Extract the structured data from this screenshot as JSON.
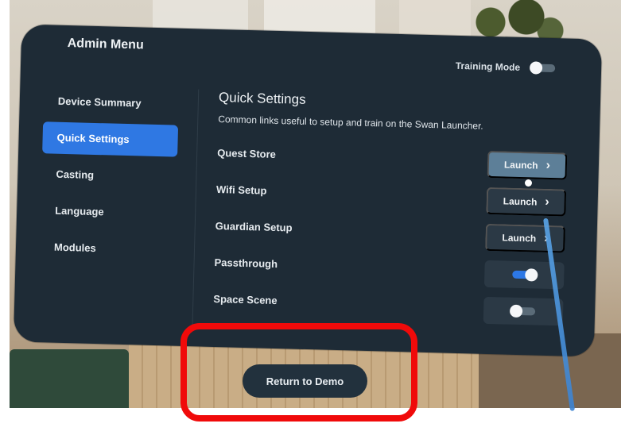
{
  "panel": {
    "title": "Admin Menu",
    "training_mode": {
      "label": "Training Mode",
      "on": false
    }
  },
  "sidebar": {
    "items": [
      {
        "label": "Device Summary",
        "active": false
      },
      {
        "label": "Quick Settings",
        "active": true
      },
      {
        "label": "Casting",
        "active": false
      },
      {
        "label": "Language",
        "active": false
      },
      {
        "label": "Modules",
        "active": false
      }
    ]
  },
  "main": {
    "title": "Quick Settings",
    "subtitle": "Common links useful to setup and train on the Swan Launcher.",
    "settings": [
      {
        "label": "Quest Store",
        "control": "launch",
        "button_label": "Launch"
      },
      {
        "label": "Wifi Setup",
        "control": "launch",
        "button_label": "Launch"
      },
      {
        "label": "Guardian Setup",
        "control": "launch",
        "button_label": "Launch"
      },
      {
        "label": "Passthrough",
        "control": "toggle",
        "on": true
      },
      {
        "label": "Space Scene",
        "control": "toggle",
        "on": false
      }
    ]
  },
  "footer": {
    "return_label": "Return to Demo"
  },
  "colors": {
    "panel": "#1e2b36",
    "accent": "#2f78e3",
    "highlight": "#f00a0a"
  },
  "icons": {
    "launch_chevron": "chevron-right-icon"
  }
}
